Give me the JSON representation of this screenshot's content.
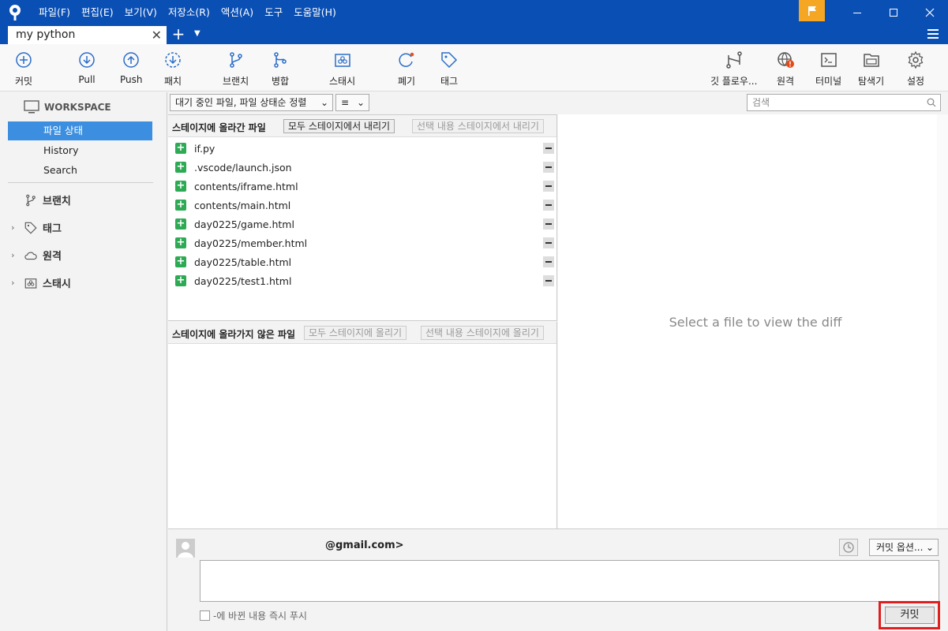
{
  "menu": [
    "파일(F)",
    "편집(E)",
    "보기(V)",
    "저장소(R)",
    "액션(A)",
    "도구",
    "도움말(H)"
  ],
  "tab": {
    "title": "my python"
  },
  "toolbar": {
    "commit": "커밋",
    "pull": "Pull",
    "push": "Push",
    "patch": "패치",
    "branch": "브랜치",
    "merge": "병합",
    "stash": "스태시",
    "discard": "폐기",
    "tag": "태그",
    "gitflow": "깃 플로우...",
    "remote": "원격",
    "terminal": "터미널",
    "explorer": "탐색기",
    "settings": "설정"
  },
  "sidebar": {
    "workspace": "WORKSPACE",
    "items": [
      "파일 상태",
      "History",
      "Search"
    ],
    "groups": [
      "브랜치",
      "태그",
      "원격",
      "스태시"
    ]
  },
  "filter": {
    "sort_label": "대기 중인 파일, 파일 상태순 정렬",
    "view_icon": "≡",
    "search_placeholder": "검색"
  },
  "staged": {
    "title": "스테이지에 올라간 파일",
    "unstage_all": "모두 스테이지에서 내리기",
    "unstage_selected": "선택 내용 스테이지에서 내리기",
    "files": [
      "if.py",
      ".vscode/launch.json",
      "contents/iframe.html",
      "contents/main.html",
      "day0225/game.html",
      "day0225/member.html",
      "day0225/table.html",
      "day0225/test1.html"
    ]
  },
  "unstaged": {
    "title": "스테이지에 올라가지 않은 파일",
    "stage_all": "모두 스테이지에 올리기",
    "stage_selected": "선택 내용 스테이지에 올리기"
  },
  "diff": {
    "message": "Select a file to view the diff"
  },
  "commit": {
    "author": "@gmail.com>",
    "options": "커밋 옵션...",
    "push_label": "-에 바뀐 내용 즉시 푸시",
    "button": "커밋"
  },
  "colors": {
    "accent": "#0a4fb4",
    "selection": "#3c8fe0",
    "added": "#2eaa55",
    "highlight": "#e02020"
  }
}
